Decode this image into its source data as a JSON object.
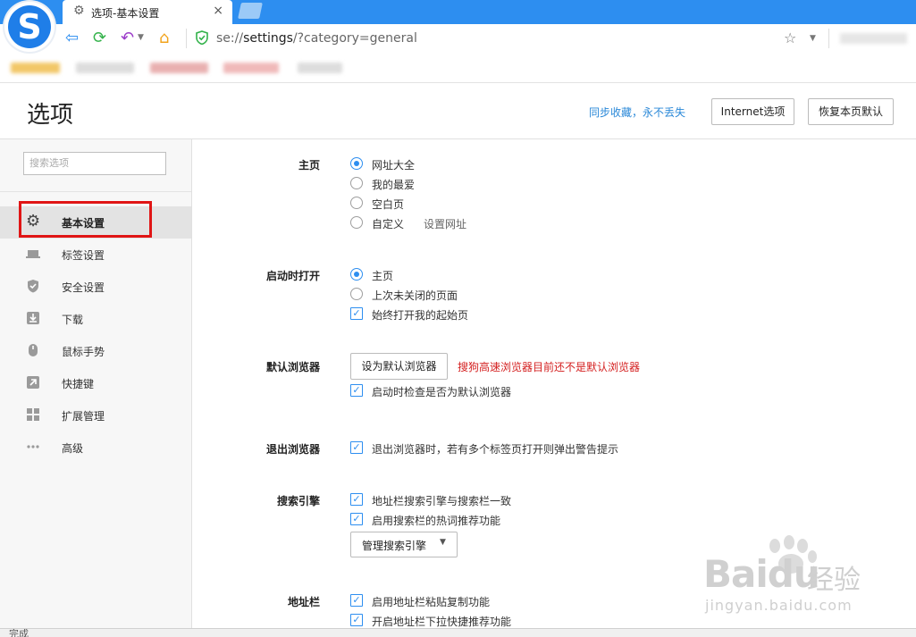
{
  "browser": {
    "logo_letter": "S",
    "tab": {
      "title": "选项-基本设置",
      "close": "×"
    },
    "address": {
      "prefix": "se://",
      "host": "settings",
      "path": "/?category=general"
    }
  },
  "header": {
    "title": "选项",
    "sync_link": "同步收藏，永不丢失",
    "internet_options": "Internet选项",
    "restore_default": "恢复本页默认"
  },
  "sidebar": {
    "search_placeholder": "搜索选项",
    "items": [
      {
        "label": "基本设置",
        "icon": "gear-icon",
        "active": true
      },
      {
        "label": "标签设置",
        "icon": "tab-icon"
      },
      {
        "label": "安全设置",
        "icon": "shield-icon"
      },
      {
        "label": "下载",
        "icon": "download-icon"
      },
      {
        "label": "鼠标手势",
        "icon": "mouse-icon"
      },
      {
        "label": "快捷键",
        "icon": "shortcut-icon"
      },
      {
        "label": "扩展管理",
        "icon": "extensions-icon"
      },
      {
        "label": "高级",
        "icon": "more-icon"
      }
    ]
  },
  "settings": {
    "homepage": {
      "label": "主页",
      "options": [
        "网址大全",
        "我的最爱",
        "空白页",
        "自定义"
      ],
      "selected": "网址大全",
      "custom_link": "设置网址"
    },
    "startup": {
      "label": "启动时打开",
      "options": [
        "主页",
        "上次未关闭的页面"
      ],
      "selected": "主页",
      "checkbox": "始终打开我的起始页"
    },
    "default_browser": {
      "label": "默认浏览器",
      "button": "设为默认浏览器",
      "warning": "搜狗高速浏览器目前还不是默认浏览器",
      "checkbox": "启动时检查是否为默认浏览器"
    },
    "exit": {
      "label": "退出浏览器",
      "checkbox": "退出浏览器时，若有多个标签页打开则弹出警告提示"
    },
    "search_engine": {
      "label": "搜索引擎",
      "checkboxes": [
        "地址栏搜索引擎与搜索栏一致",
        "启用搜索栏的热词推荐功能"
      ],
      "manage_button": "管理搜索引擎"
    },
    "address_bar": {
      "label": "地址栏",
      "checkboxes": [
        "启用地址栏粘贴复制功能",
        "开启地址栏下拉快捷推荐功能"
      ]
    }
  },
  "watermark": {
    "brand": "Bai",
    "brand2": "du",
    "cn": "经验",
    "url": "jingyan.baidu.com"
  },
  "status": "完成",
  "colors": {
    "accent": "#2d8ef0",
    "warning": "#d42020",
    "highlight_outline": "#e01515"
  }
}
